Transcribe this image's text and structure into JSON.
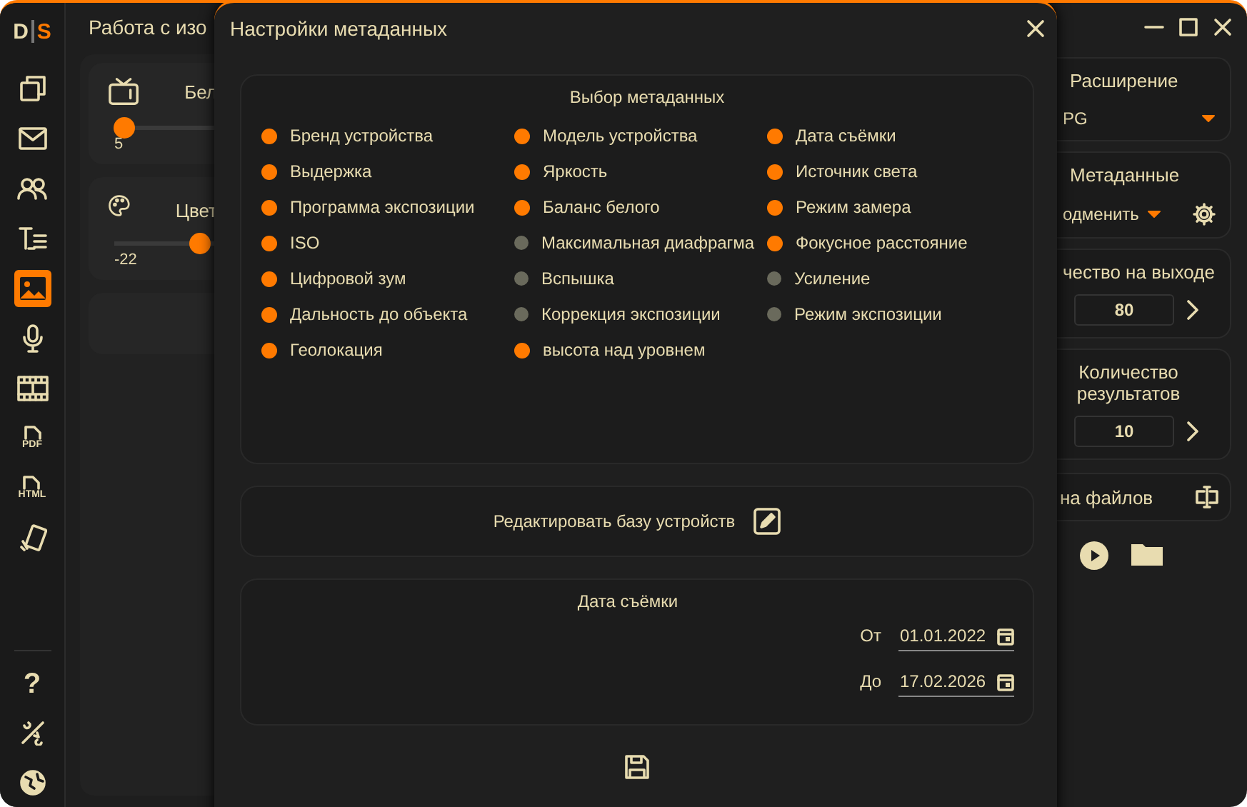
{
  "app": {
    "logo": {
      "left": "D",
      "right": "S"
    },
    "title": "Работа с изо",
    "sidebar": {
      "items": [
        {
          "selected": false
        },
        {
          "selected": false
        },
        {
          "selected": false
        },
        {
          "selected": false
        },
        {
          "selected": true
        },
        {
          "selected": false
        },
        {
          "selected": false
        },
        {
          "label": "PDF",
          "selected": false
        },
        {
          "label": "HTML",
          "selected": false
        },
        {
          "selected": false
        }
      ],
      "help": "?"
    },
    "left_panels": [
      {
        "label": "Бел",
        "slider": {
          "level": 0.1
        },
        "reading": "5"
      },
      {
        "label": "Цвет",
        "slider": {
          "level": 0.83
        },
        "reading": "-22"
      }
    ],
    "right_panels": {
      "extension": {
        "label": "Расширение",
        "value": "PG"
      },
      "metadata": {
        "label": "Метаданные",
        "value": "одменить"
      },
      "quality": {
        "label": "чество на выходе",
        "value": "80"
      },
      "results": {
        "label": "Количество результатов",
        "value": "10"
      },
      "file_names": {
        "label": "на файлов"
      }
    }
  },
  "dialog": {
    "title": "Настройки метаданных",
    "metadata_selection": {
      "title": "Выбор метаданных",
      "items": [
        {
          "label": "Бренд устройства",
          "checked": true
        },
        {
          "label": "Модель устройства",
          "checked": true
        },
        {
          "label": "Дата съёмки",
          "checked": true
        },
        {
          "label": "Выдержка",
          "checked": true
        },
        {
          "label": "Яркость",
          "checked": true
        },
        {
          "label": "Источник света",
          "checked": true
        },
        {
          "label": "Программа экспозиции",
          "checked": true
        },
        {
          "label": "Баланс белого",
          "checked": true
        },
        {
          "label": "Режим замера",
          "checked": true
        },
        {
          "label": "ISO",
          "checked": true
        },
        {
          "label": "Максимальная диафрагма",
          "checked": false
        },
        {
          "label": "Фокусное расстояние",
          "checked": true
        },
        {
          "label": "Цифровой зум",
          "checked": true
        },
        {
          "label": "Вспышка",
          "checked": false
        },
        {
          "label": "Усиление",
          "checked": false
        },
        {
          "label": "Дальность до объекта",
          "checked": true
        },
        {
          "label": "Коррекция экспозиции",
          "checked": false
        },
        {
          "label": "Режим экспозиции",
          "checked": false
        },
        {
          "label": "Геолокация",
          "checked": true
        },
        {
          "label": "высота над уровнем",
          "checked": true
        }
      ]
    },
    "edit_devices": {
      "label": "Редактировать базу устройств"
    },
    "shooting_date": {
      "title": "Дата съёмки",
      "from": {
        "label": "От",
        "value": "01.01.2022"
      },
      "to": {
        "label": "До",
        "value": "17.02.2026"
      }
    }
  }
}
